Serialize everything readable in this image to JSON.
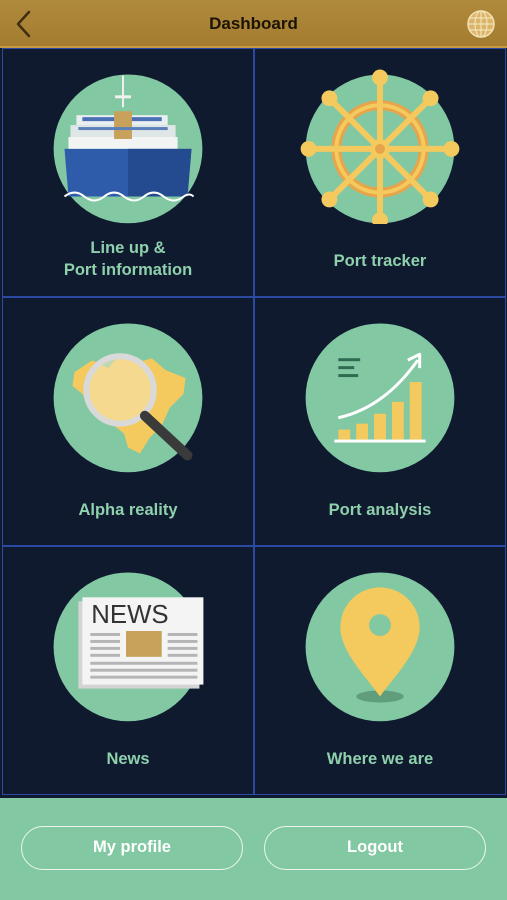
{
  "header": {
    "title": "Dashboard",
    "back_icon": "chevron-left-icon",
    "globe_icon": "globe-icon"
  },
  "tiles": [
    {
      "label_line1": "Line up &",
      "label_line2": "Port information",
      "icon": "ship-icon"
    },
    {
      "label": "Port tracker",
      "icon": "ship-wheel-icon"
    },
    {
      "label": "Alpha reality",
      "icon": "magnifier-map-icon"
    },
    {
      "label": "Port analysis",
      "icon": "growth-chart-icon"
    },
    {
      "label": "News",
      "icon": "newspaper-icon",
      "newspaper_text": "NEWS"
    },
    {
      "label": "Where we are",
      "icon": "location-pin-icon"
    }
  ],
  "footer": {
    "profile_label": "My profile",
    "logout_label": "Logout"
  },
  "colors": {
    "header_bg": "#a9843a",
    "tile_bg": "#0f1a2f",
    "tile_border": "#2c4aa3",
    "circle": "#82c8a3",
    "label": "#8fd1ac",
    "accent_yellow": "#f4c95d",
    "footer_bg": "#82c8a3"
  }
}
